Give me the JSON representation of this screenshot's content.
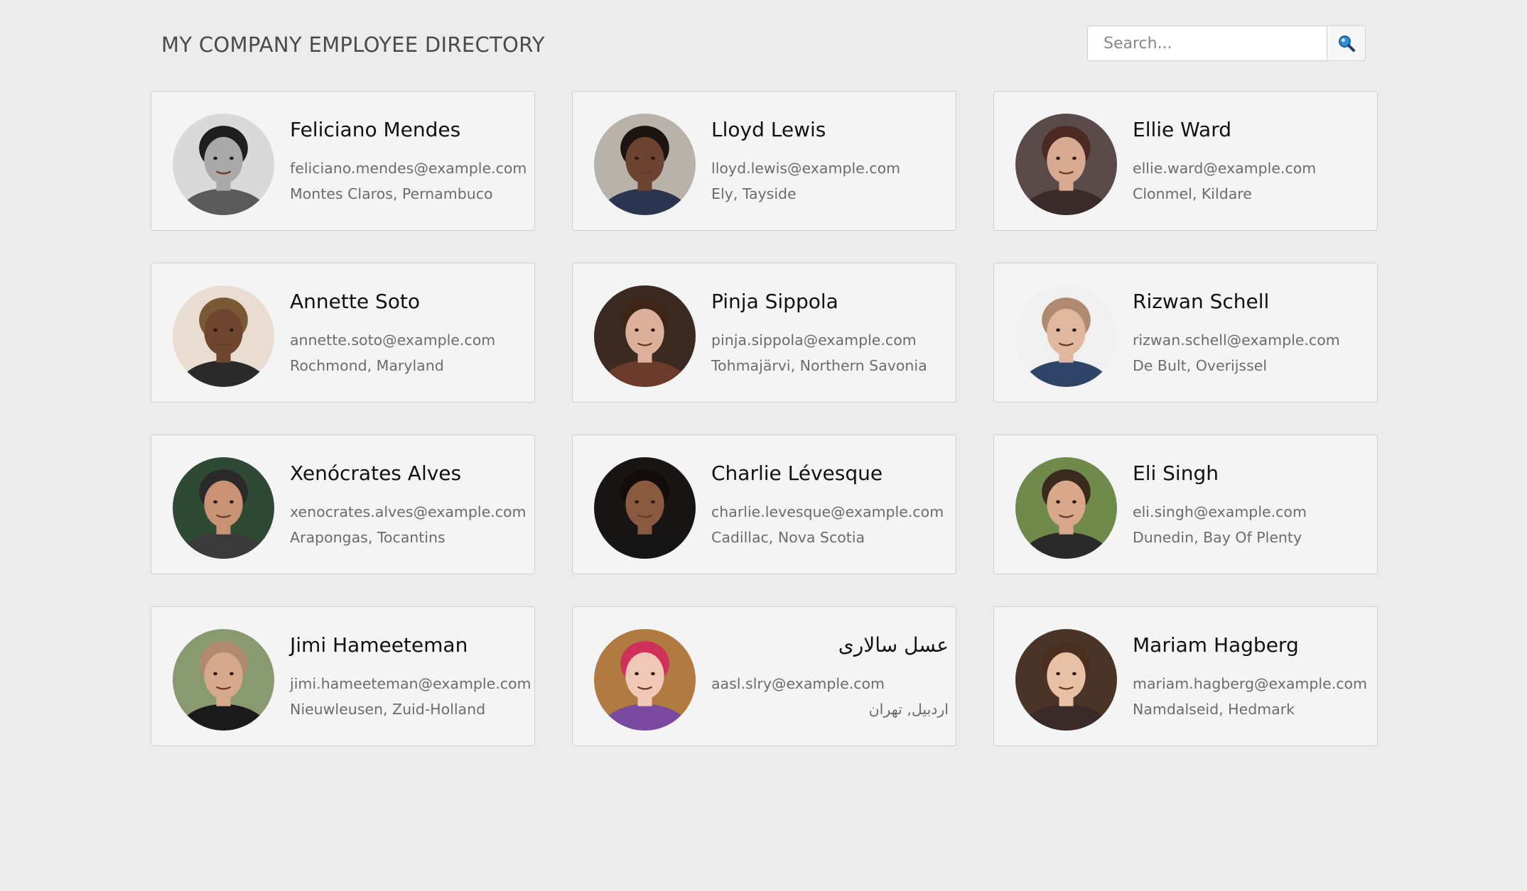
{
  "header": {
    "title": "MY COMPANY EMPLOYEE DIRECTORY",
    "search_placeholder": "Search...",
    "search_icon": "magnifier-icon"
  },
  "employees": [
    {
      "name": "Feliciano Mendes",
      "email": "feliciano.mendes@example.com",
      "location": "Montes Claros, Pernambuco"
    },
    {
      "name": "Lloyd Lewis",
      "email": "lloyd.lewis@example.com",
      "location": "Ely, Tayside"
    },
    {
      "name": "Ellie Ward",
      "email": "ellie.ward@example.com",
      "location": "Clonmel, Kildare"
    },
    {
      "name": "Annette Soto",
      "email": "annette.soto@example.com",
      "location": "Rochmond, Maryland"
    },
    {
      "name": "Pinja Sippola",
      "email": "pinja.sippola@example.com",
      "location": "Tohmajärvi, Northern Savonia"
    },
    {
      "name": "Rizwan Schell",
      "email": "rizwan.schell@example.com",
      "location": "De Bult, Overijssel"
    },
    {
      "name": "Xenócrates Alves",
      "email": "xenocrates.alves@example.com",
      "location": "Arapongas, Tocantins"
    },
    {
      "name": "Charlie Lévesque",
      "email": "charlie.levesque@example.com",
      "location": "Cadillac, Nova Scotia"
    },
    {
      "name": "Eli Singh",
      "email": "eli.singh@example.com",
      "location": "Dunedin, Bay Of Plenty"
    },
    {
      "name": "Jimi Hameeteman",
      "email": "jimi.hameeteman@example.com",
      "location": "Nieuwleusen, Zuid-Holland"
    },
    {
      "name": "عسل سالاری",
      "email": "aasl.slry@example.com",
      "location": "اردبیل, تهران"
    },
    {
      "name": "Mariam Hagberg",
      "email": "mariam.hagberg@example.com",
      "location": "Namdalseid, Hedmark"
    }
  ],
  "avatars": [
    {
      "bg": "#d9d9d9",
      "hair": "#1e1e1e",
      "skin": "#a9a9a9",
      "shirt": "#5a5a5a"
    },
    {
      "bg": "#b9b2ab",
      "hair": "#1c1410",
      "skin": "#6b4330",
      "shirt": "#2c3550"
    },
    {
      "bg": "#5b4a4a",
      "hair": "#4a2a22",
      "skin": "#d9aa92",
      "shirt": "#3a2a2a"
    },
    {
      "bg": "#e8ddd0",
      "hair": "#7a5a35",
      "skin": "#6f4630",
      "shirt": "#2a2a2a"
    },
    {
      "bg": "#3a2a22",
      "hair": "#3d2617",
      "skin": "#dcb09a",
      "shirt": "#6b3a2a"
    },
    {
      "bg": "#f0f0f0",
      "hair": "#b08a70",
      "skin": "#e0b8a0",
      "shirt": "#2f4466"
    },
    {
      "bg": "#2f4a34",
      "hair": "#2a2a2a",
      "skin": "#c89274",
      "shirt": "#3a3a3a"
    },
    {
      "bg": "#1a1515",
      "hair": "#120d0b",
      "skin": "#8a5a40",
      "shirt": "#151515"
    },
    {
      "bg": "#6f8a4a",
      "hair": "#3a2a1e",
      "skin": "#d9a88a",
      "shirt": "#2a2a2a"
    },
    {
      "bg": "#8a9a70",
      "hair": "#b08a70",
      "skin": "#d7a98c",
      "shirt": "#1a1a1a"
    },
    {
      "bg": "#b07a40",
      "hair": "#d0305a",
      "skin": "#f0c8b8",
      "shirt": "#7a4aa0"
    },
    {
      "bg": "#4a3428",
      "hair": "#4a2e20",
      "skin": "#e8c0a6",
      "shirt": "#3a2a2a"
    }
  ]
}
